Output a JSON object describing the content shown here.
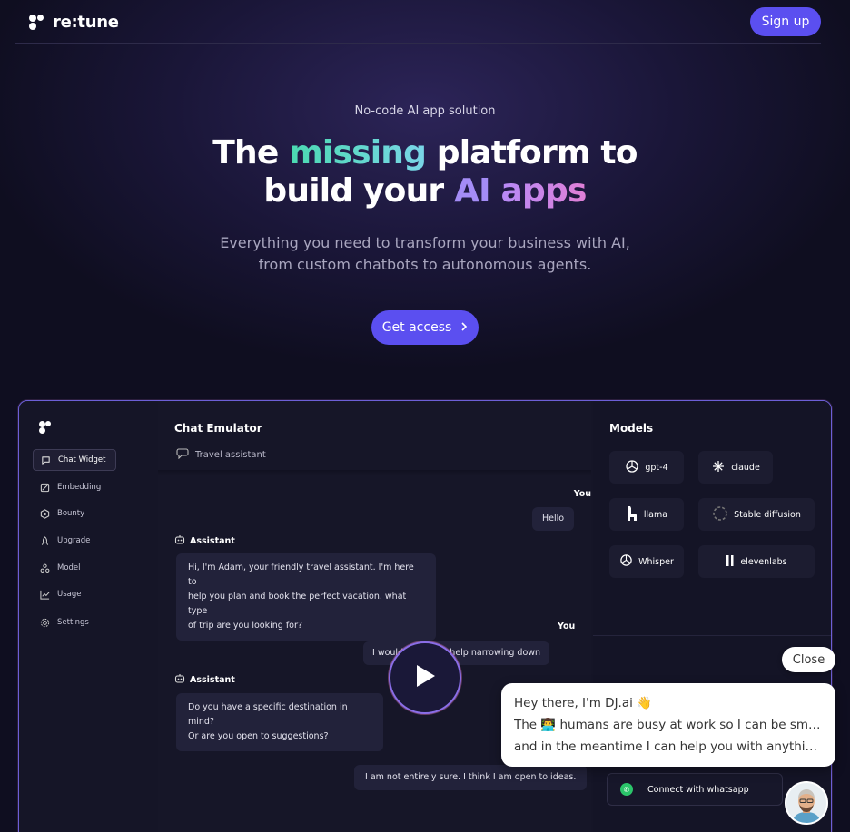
{
  "nav": {
    "brand": "re:tune",
    "signup_label": "Sign up"
  },
  "hero": {
    "eyebrow": "No-code AI app solution",
    "title_part1": "The ",
    "title_highlight1": "missing",
    "title_part2": " platform to",
    "title_part3": "build your ",
    "title_highlight2": "AI",
    "title_highlight3": "apps",
    "subtitle_line1": "Everything you need to transform your business with AI,",
    "subtitle_line2": "from custom chatbots to autonomous agents.",
    "cta_label": "Get access"
  },
  "app": {
    "sidebar": [
      {
        "label": "Chat Widget",
        "icon": "chat-icon"
      },
      {
        "label": "Embedding",
        "icon": "embedding-icon"
      },
      {
        "label": "Bounty",
        "icon": "bounty-icon"
      },
      {
        "label": "Upgrade",
        "icon": "rocket-icon"
      },
      {
        "label": "Model",
        "icon": "model-icon"
      },
      {
        "label": "Usage",
        "icon": "chart-icon"
      },
      {
        "label": "Settings",
        "icon": "gear-icon"
      }
    ],
    "chat": {
      "title": "Chat Emulator",
      "subtitle": "Travel assistant",
      "you_label": "You",
      "assistant_label": "Assistant",
      "messages": [
        "Hello",
        "Hi, I'm Adam, your friendly travel assistant. I'm here to",
        "help you plan and book the perfect vacation. what type",
        "of trip are you looking for?",
        "I would like some help narrowing down",
        "Do you have a specific destination in mind?",
        "Or are you open to suggestions?",
        "I am not entirely sure. I think I am open to ideas."
      ]
    },
    "models": {
      "title": "Models",
      "items": [
        "gpt-4",
        "claude",
        "llama",
        "Stable diffusion",
        "Whisper",
        "elevenlabs"
      ],
      "whatsapp_label": "Connect with whatsapp"
    }
  },
  "widget": {
    "close_label": "Close",
    "line1": "Hey there, I'm DJ.ai 👋",
    "line2": "The 👨‍💻 humans are busy at work so I can be smarter,",
    "line3": "and in the meantime I can help you with anything you need"
  }
}
